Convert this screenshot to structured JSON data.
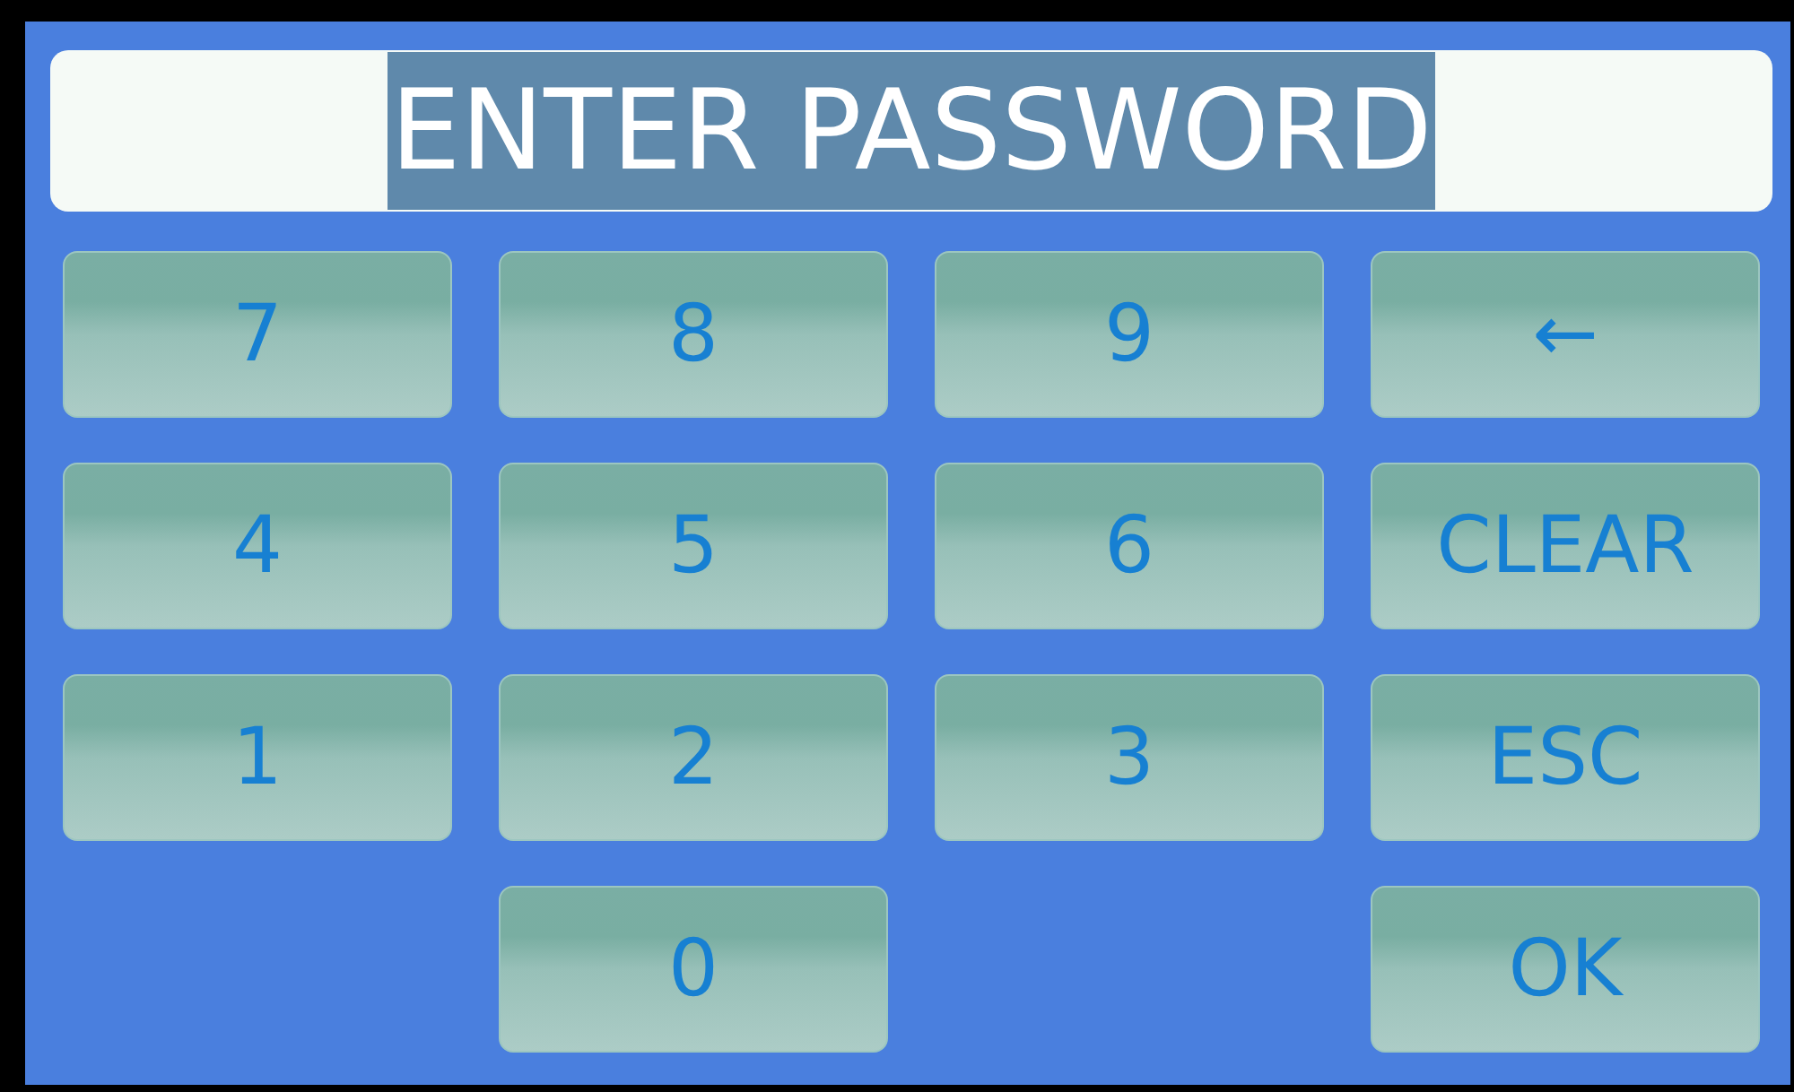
{
  "display": {
    "text": "ENTER PASSWORD",
    "highlighted": true
  },
  "keypad": [
    [
      {
        "kind": "key",
        "label": "7"
      },
      {
        "kind": "key",
        "label": "8"
      },
      {
        "kind": "key",
        "label": "9"
      },
      {
        "kind": "key",
        "label": "←"
      }
    ],
    [
      {
        "kind": "key",
        "label": "4"
      },
      {
        "kind": "key",
        "label": "5"
      },
      {
        "kind": "key",
        "label": "6"
      },
      {
        "kind": "key",
        "label": "CLEAR"
      }
    ],
    [
      {
        "kind": "key",
        "label": "1"
      },
      {
        "kind": "key",
        "label": "2"
      },
      {
        "kind": "key",
        "label": "3"
      },
      {
        "kind": "key",
        "label": "ESC"
      }
    ],
    [
      {
        "kind": "empty"
      },
      {
        "kind": "key",
        "label": "0"
      },
      {
        "kind": "empty"
      },
      {
        "kind": "key",
        "label": "OK"
      }
    ]
  ]
}
